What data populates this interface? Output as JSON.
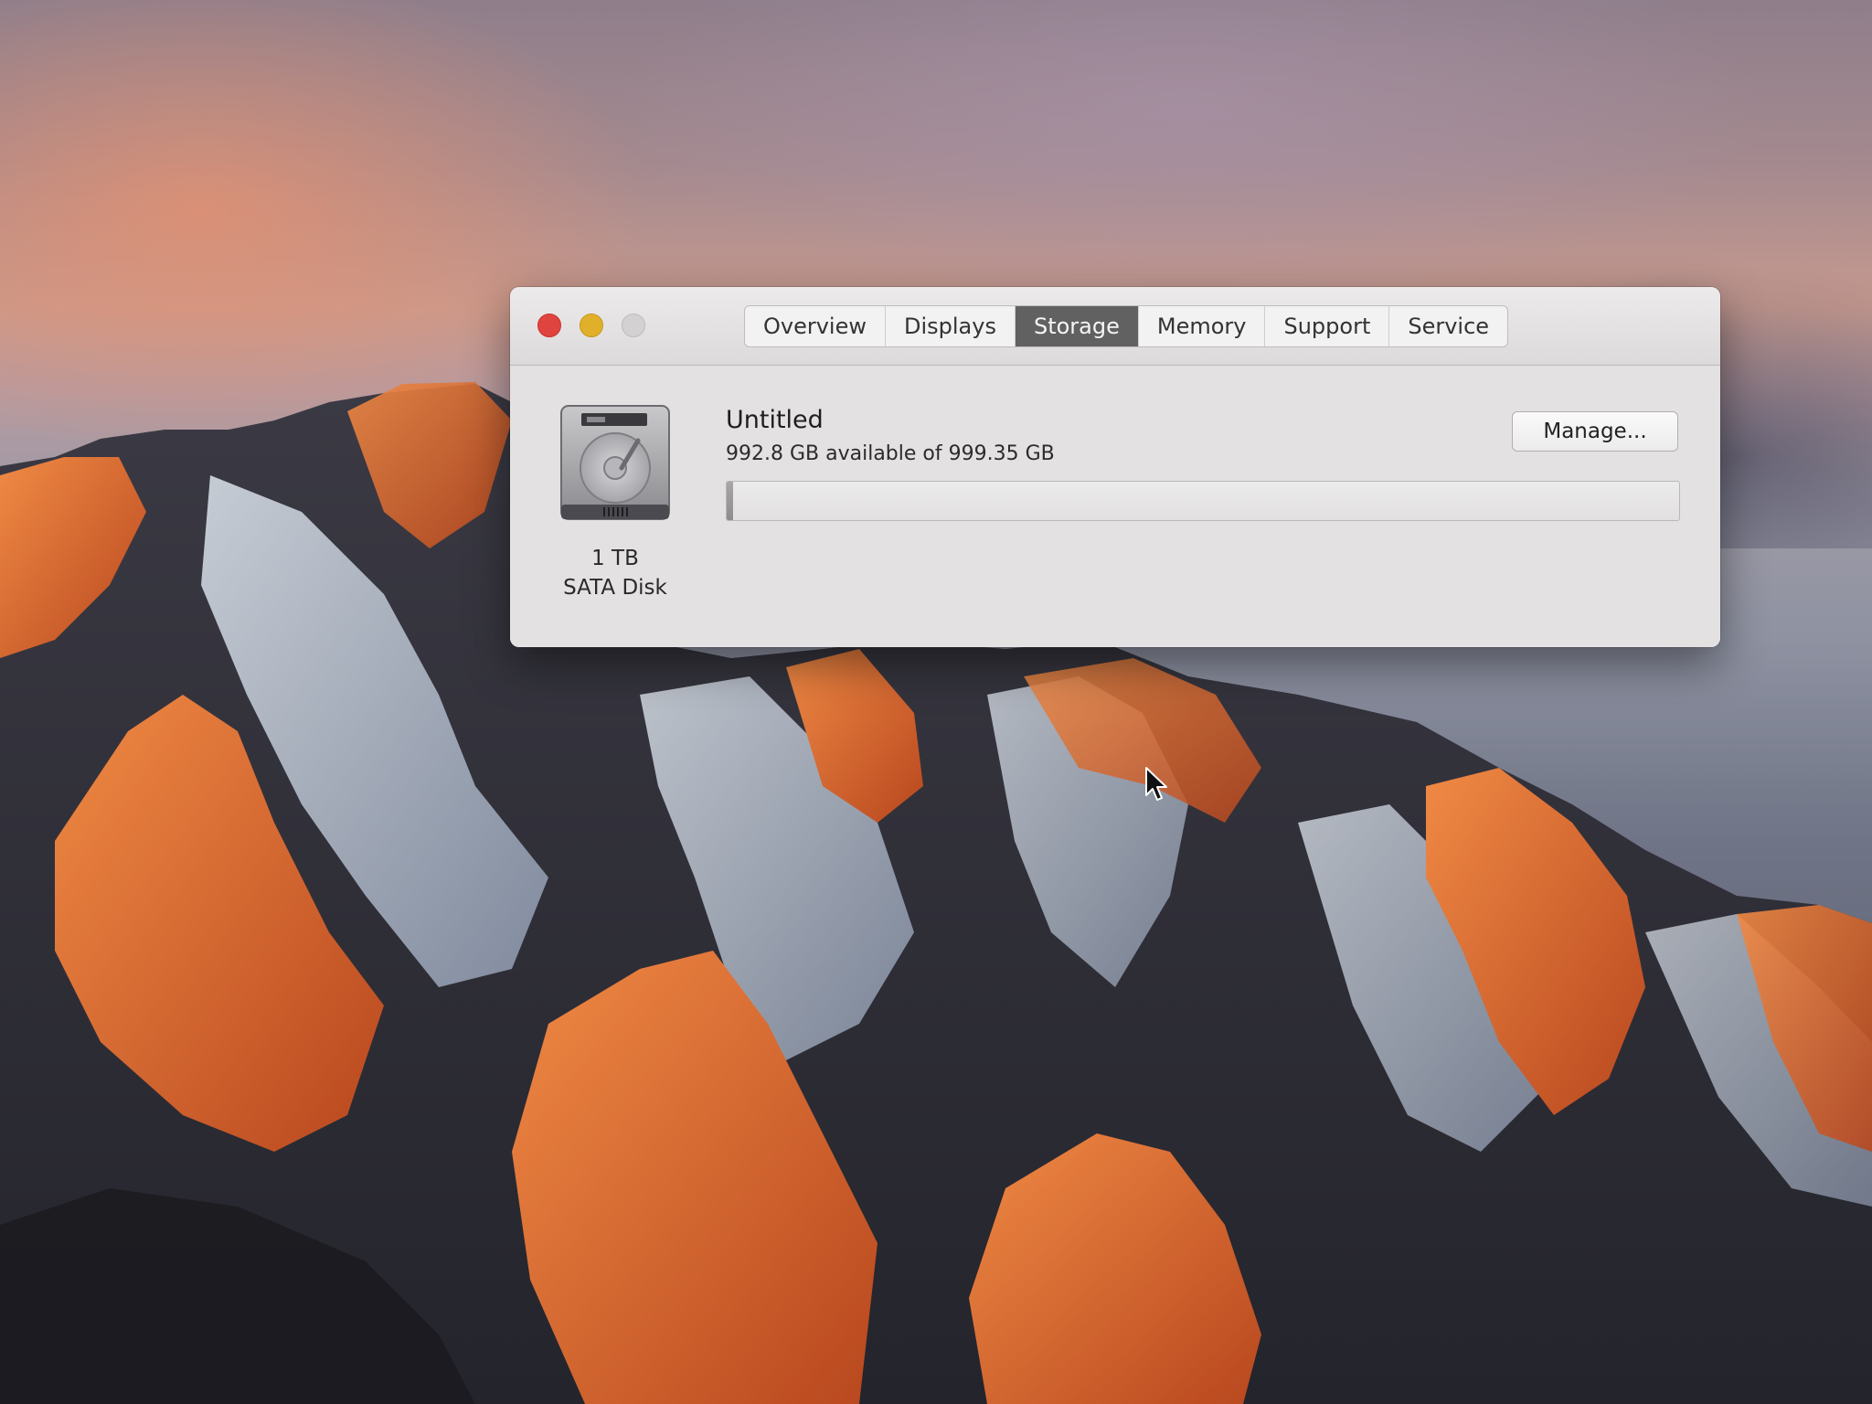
{
  "window": {
    "tabs": [
      {
        "label": "Overview",
        "selected": false
      },
      {
        "label": "Displays",
        "selected": false
      },
      {
        "label": "Storage",
        "selected": true
      },
      {
        "label": "Memory",
        "selected": false
      },
      {
        "label": "Support",
        "selected": false
      },
      {
        "label": "Service",
        "selected": false
      }
    ],
    "traffic_lights": {
      "close": "#e0443e",
      "minimize": "#e1b02a",
      "zoom": "#d3d1d1"
    }
  },
  "storage": {
    "disk_icon": "hard-drive-icon",
    "disk_size": "1 TB",
    "disk_type": "SATA Disk",
    "volume_name": "Untitled",
    "availability": "992.8 GB available of 999.35 GB",
    "used_fraction": 0.0066,
    "manage_label": "Manage..."
  },
  "colors": {
    "selected_tab": "#616161",
    "window_bg": "#e3e1e1"
  }
}
